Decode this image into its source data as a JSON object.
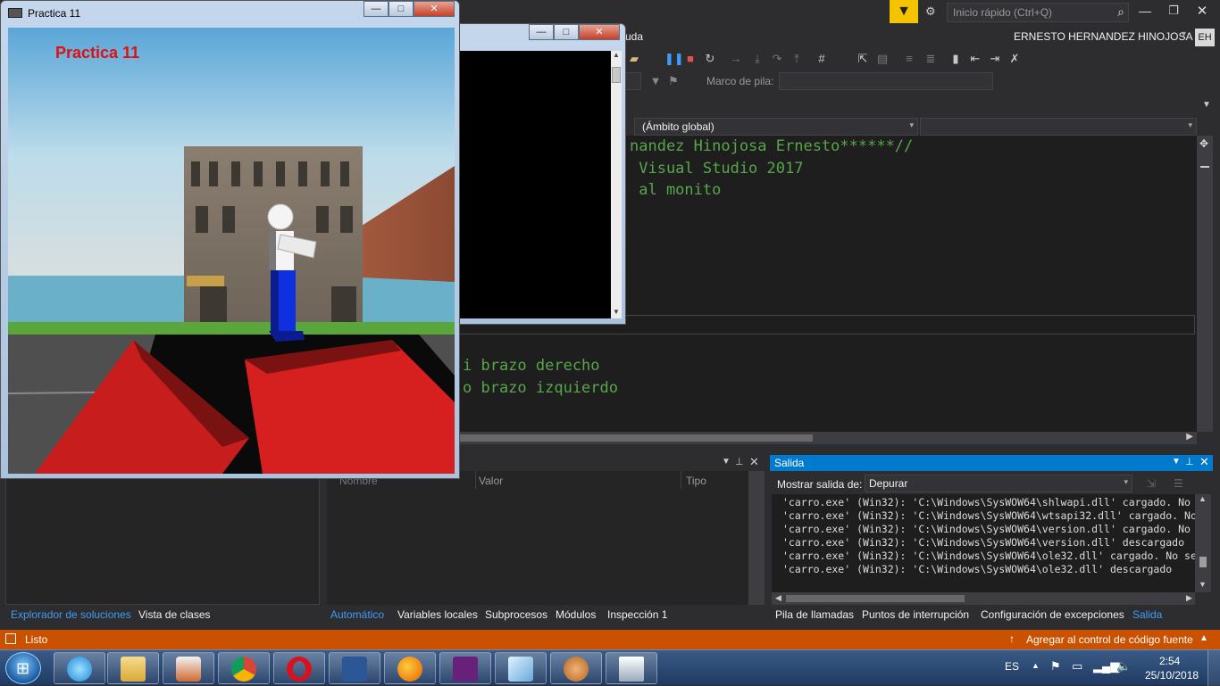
{
  "vs": {
    "quick_launch_placeholder": "Inicio rápido (Ctrl+Q)",
    "user_name": "ERNESTO HERNANDEZ HINOJOSA",
    "user_initials": "EH",
    "menu_partial": "uda",
    "stack_frame_label": "Marco de pila:",
    "scope_dropdown": "(Ámbito global)",
    "code_lines": [
      "nandez Hinojosa Ernesto******//",
      " Visual Studio 2017",
      " al monito",
      "i brazo derecho",
      "o brazo izquierdo"
    ],
    "locals_columns": [
      "Nombre",
      "Valor",
      "Tipo"
    ],
    "left_tabs": [
      "Explorador de soluciones",
      "Vista de clases"
    ],
    "mid_tabs": [
      "Automático",
      "Variables locales",
      "Subprocesos",
      "Módulos",
      "Inspección 1"
    ],
    "right_tabs": [
      "Pila de llamadas",
      "Puntos de interrupción",
      "Configuración de excepciones",
      "Salida"
    ],
    "output": {
      "title": "Salida",
      "show_label": "Mostrar salida de:",
      "source": "Depurar",
      "lines": [
        "'carro.exe' (Win32): 'C:\\Windows\\SysWOW64\\shlwapi.dll' cargado. No",
        "'carro.exe' (Win32): 'C:\\Windows\\SysWOW64\\wtsapi32.dll' cargado. No",
        "'carro.exe' (Win32): 'C:\\Windows\\SysWOW64\\version.dll' cargado. No",
        "'carro.exe' (Win32): 'C:\\Windows\\SysWOW64\\version.dll' descargado",
        "'carro.exe' (Win32): 'C:\\Windows\\SysWOW64\\ole32.dll' cargado. No se",
        "'carro.exe' (Win32): 'C:\\Windows\\SysWOW64\\ole32.dll' descargado"
      ]
    },
    "status_text": "Listo",
    "source_control": "Agregar al control de código fuente"
  },
  "practica_window": {
    "title": "Practica 11",
    "overlay_text": "Practica 11"
  },
  "taskbar": {
    "lang": "ES",
    "time": "2:54",
    "date": "25/10/2018"
  },
  "colors": {
    "vs_bg": "#2d2d30",
    "editor_bg": "#1e1e1e",
    "accent_blue": "#007acc",
    "status_orange": "#ca5100",
    "comment_green": "#57a64a",
    "overlay_red": "#e01010"
  }
}
